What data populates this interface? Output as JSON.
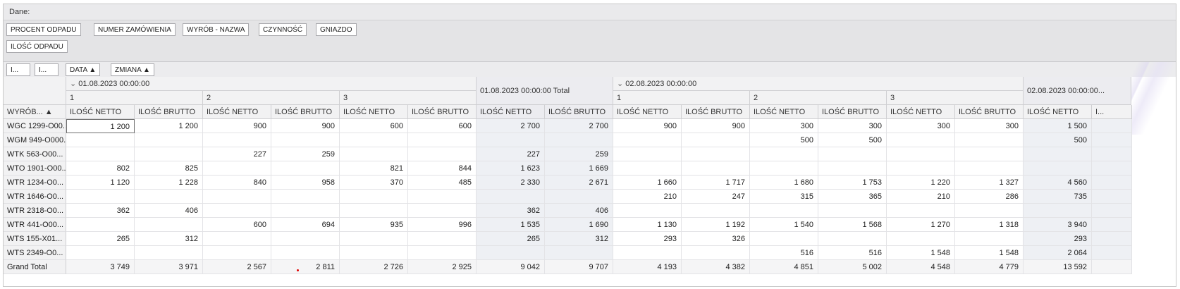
{
  "window": {
    "title": "Dane:"
  },
  "filter_fields": [
    "PROCENT ODPADU",
    "NUMER ZAMÓWIENIA",
    "WYRÓB - NAZWA",
    "CZYNNOŚĆ",
    "GNIAZDO"
  ],
  "data_fields": [
    "ILOŚĆ ODPADU"
  ],
  "row_field_buttons": [
    "I...",
    "I..."
  ],
  "column_fields": [
    {
      "label": "DATA",
      "sort_icon": "sort-ascending-icon"
    },
    {
      "label": "ZMIANA",
      "sort_icon": "sort-ascending-icon"
    }
  ],
  "row_header": {
    "label": "WYRÓB...",
    "sort_icon": "sort-ascending-icon"
  },
  "dates": [
    {
      "label": "01.08.2023 00:00:00",
      "total_label": "01.08.2023 00:00:00 Total",
      "expand_icon": "collapse-chevron-icon"
    },
    {
      "label": "02.08.2023 00:00:00",
      "total_label": "02.08.2023 00:00:00...",
      "expand_icon": "collapse-chevron-icon"
    }
  ],
  "shifts": [
    "1",
    "2",
    "3"
  ],
  "measures": [
    "ILOŚĆ NETTO",
    "ILOŚĆ BRUTTO"
  ],
  "last_col_label": "I...",
  "rows": [
    {
      "name": "WGC 1299-O00...",
      "values": [
        "1 200",
        "1 200",
        "900",
        "900",
        "600",
        "600",
        "2 700",
        "2 700",
        "900",
        "900",
        "300",
        "300",
        "300",
        "300",
        "1 500"
      ]
    },
    {
      "name": "WGM 949-O000...",
      "values": [
        "",
        "",
        "",
        "",
        "",
        "",
        "",
        "",
        "",
        "",
        "500",
        "500",
        "",
        "",
        "500"
      ]
    },
    {
      "name": "WTK 563-O00...",
      "values": [
        "",
        "",
        "227",
        "259",
        "",
        "",
        "227",
        "259",
        "",
        "",
        "",
        "",
        "",
        "",
        ""
      ]
    },
    {
      "name": "WTO 1901-O00...",
      "values": [
        "802",
        "825",
        "",
        "",
        "821",
        "844",
        "1 623",
        "1 669",
        "",
        "",
        "",
        "",
        "",
        "",
        ""
      ]
    },
    {
      "name": "WTR 1234-O0...",
      "values": [
        "1 120",
        "1 228",
        "840",
        "958",
        "370",
        "485",
        "2 330",
        "2 671",
        "1 660",
        "1 717",
        "1 680",
        "1 753",
        "1 220",
        "1 327",
        "4 560"
      ]
    },
    {
      "name": "WTR 1646-O0...",
      "values": [
        "",
        "",
        "",
        "",
        "",
        "",
        "",
        "",
        "210",
        "247",
        "315",
        "365",
        "210",
        "286",
        "735"
      ]
    },
    {
      "name": "WTR 2318-O0...",
      "values": [
        "362",
        "406",
        "",
        "",
        "",
        "",
        "362",
        "406",
        "",
        "",
        "",
        "",
        "",
        "",
        ""
      ]
    },
    {
      "name": "WTR 441-O00...",
      "values": [
        "",
        "",
        "600",
        "694",
        "935",
        "996",
        "1 535",
        "1 690",
        "1 130",
        "1 192",
        "1 540",
        "1 568",
        "1 270",
        "1 318",
        "3 940"
      ]
    },
    {
      "name": "WTS 155-X01...",
      "values": [
        "265",
        "312",
        "",
        "",
        "",
        "",
        "265",
        "312",
        "293",
        "326",
        "",
        "",
        "",
        "",
        "293"
      ]
    },
    {
      "name": "WTS 2349-O0...",
      "values": [
        "",
        "",
        "",
        "",
        "",
        "",
        "",
        "",
        "",
        "",
        "516",
        "516",
        "1 548",
        "1 548",
        "2 064"
      ]
    }
  ],
  "grand_total": {
    "name": "Grand Total",
    "values": [
      "3 749",
      "3 971",
      "2 567",
      "2 811",
      "2 726",
      "2 925",
      "9 042",
      "9 707",
      "4 193",
      "4 382",
      "4 851",
      "5 002",
      "4 548",
      "4 779",
      "13 592"
    ]
  }
}
